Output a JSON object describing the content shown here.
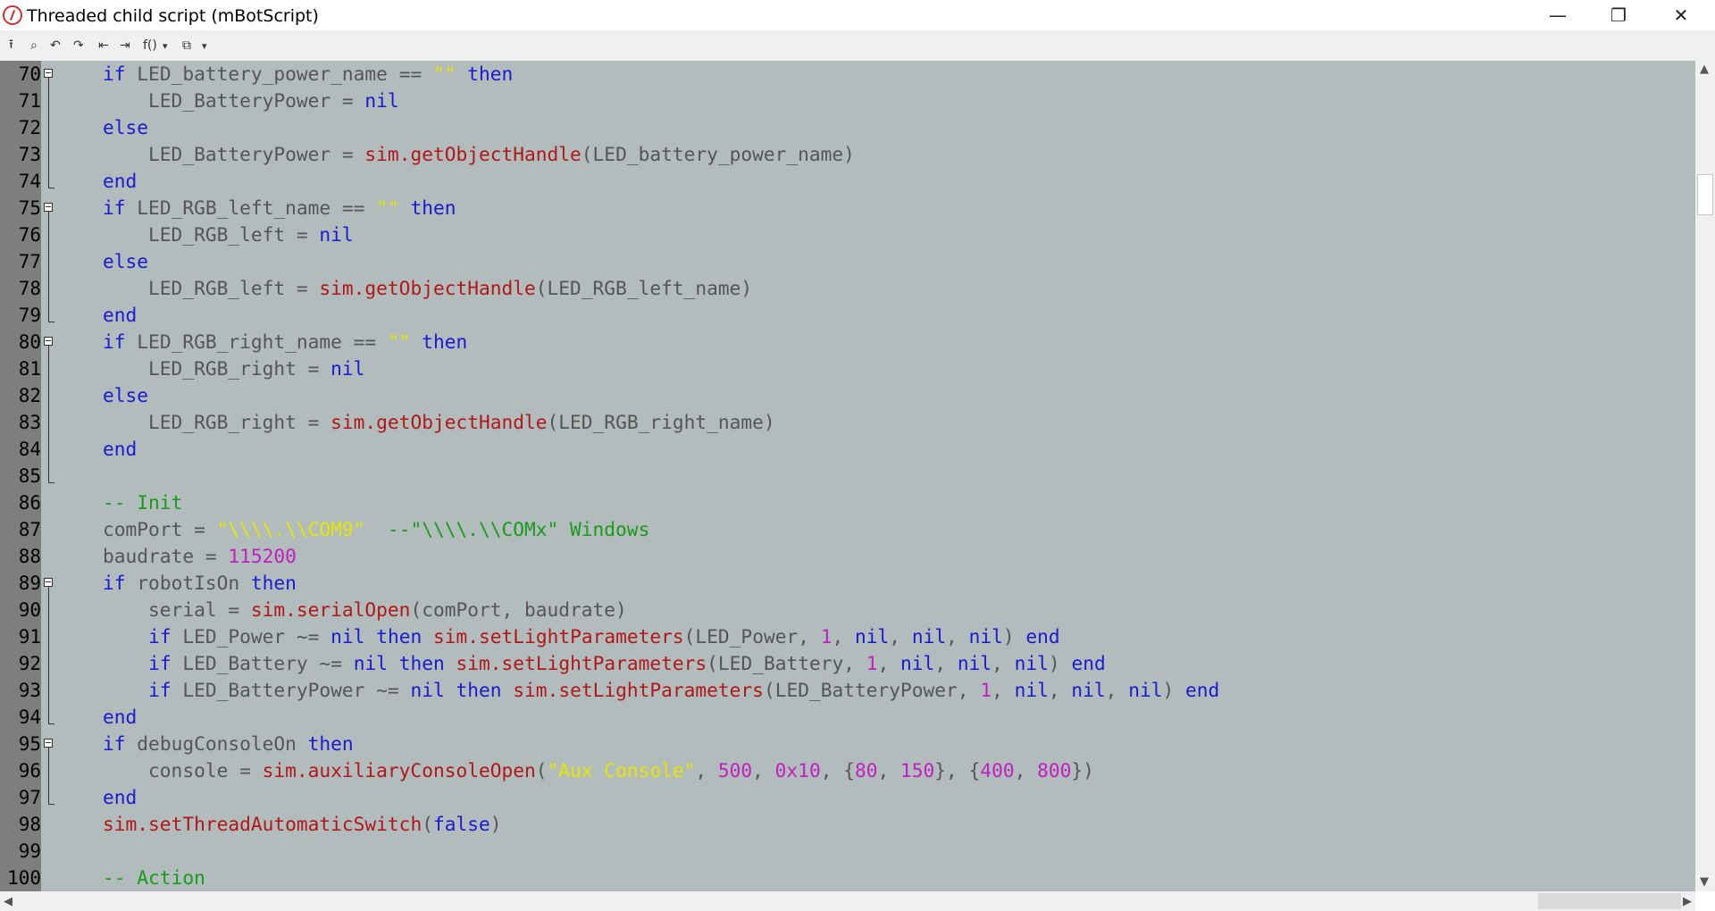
{
  "window": {
    "title": "Threaded child script (mBotScript)",
    "minimize_glyph": "—",
    "restore_glyph": "❐",
    "close_glyph": "✕"
  },
  "toolbar": {
    "buttons": [
      {
        "icon": "upload-icon",
        "glyph": "⭱"
      },
      {
        "icon": "search-icon",
        "glyph": "⌕"
      },
      {
        "icon": "undo-icon",
        "glyph": "↶"
      },
      {
        "icon": "redo-icon",
        "glyph": "↷"
      },
      {
        "icon": "outdent-icon",
        "glyph": "⇤"
      },
      {
        "icon": "indent-icon",
        "glyph": "⇥"
      },
      {
        "icon": "functions-icon",
        "glyph": "f()"
      },
      {
        "icon": "dropdown-icon",
        "glyph": "▾"
      },
      {
        "icon": "snippets-icon",
        "glyph": "⧉"
      },
      {
        "icon": "dropdown-icon",
        "glyph": "▾"
      }
    ]
  },
  "editor": {
    "lines": [
      {
        "n": "70",
        "fold": "start",
        "segs": [
          [
            "p",
            "    "
          ],
          [
            "kw",
            "if"
          ],
          [
            "p",
            " LED_battery_power_name == "
          ],
          [
            "str",
            "\"\""
          ],
          [
            "p",
            " "
          ],
          [
            "kw",
            "then"
          ]
        ]
      },
      {
        "n": "71",
        "fold": "mid",
        "segs": [
          [
            "p",
            "        LED_BatteryPower = "
          ],
          [
            "kw",
            "nil"
          ]
        ]
      },
      {
        "n": "72",
        "fold": "mid",
        "segs": [
          [
            "p",
            "    "
          ],
          [
            "kw",
            "else"
          ]
        ]
      },
      {
        "n": "73",
        "fold": "mid",
        "segs": [
          [
            "p",
            "        LED_BatteryPower = "
          ],
          [
            "fn",
            "sim.getObjectHandle"
          ],
          [
            "p",
            "(LED_battery_power_name)"
          ]
        ]
      },
      {
        "n": "74",
        "fold": "end",
        "segs": [
          [
            "p",
            "    "
          ],
          [
            "kw",
            "end"
          ]
        ]
      },
      {
        "n": "75",
        "fold": "start",
        "segs": [
          [
            "p",
            "    "
          ],
          [
            "kw",
            "if"
          ],
          [
            "p",
            " LED_RGB_left_name == "
          ],
          [
            "str",
            "\"\""
          ],
          [
            "p",
            " "
          ],
          [
            "kw",
            "then"
          ]
        ]
      },
      {
        "n": "76",
        "fold": "mid",
        "segs": [
          [
            "p",
            "        LED_RGB_left = "
          ],
          [
            "kw",
            "nil"
          ]
        ]
      },
      {
        "n": "77",
        "fold": "mid",
        "segs": [
          [
            "p",
            "    "
          ],
          [
            "kw",
            "else"
          ]
        ]
      },
      {
        "n": "78",
        "fold": "mid",
        "segs": [
          [
            "p",
            "        LED_RGB_left = "
          ],
          [
            "fn",
            "sim.getObjectHandle"
          ],
          [
            "p",
            "(LED_RGB_left_name)"
          ]
        ]
      },
      {
        "n": "79",
        "fold": "end",
        "segs": [
          [
            "p",
            "    "
          ],
          [
            "kw",
            "end"
          ]
        ]
      },
      {
        "n": "80",
        "fold": "start",
        "segs": [
          [
            "p",
            "    "
          ],
          [
            "kw",
            "if"
          ],
          [
            "p",
            " LED_RGB_right_name == "
          ],
          [
            "str",
            "\"\""
          ],
          [
            "p",
            " "
          ],
          [
            "kw",
            "then"
          ]
        ]
      },
      {
        "n": "81",
        "fold": "mid",
        "segs": [
          [
            "p",
            "        LED_RGB_right = "
          ],
          [
            "kw",
            "nil"
          ]
        ]
      },
      {
        "n": "82",
        "fold": "mid",
        "segs": [
          [
            "p",
            "    "
          ],
          [
            "kw",
            "else"
          ]
        ]
      },
      {
        "n": "83",
        "fold": "mid",
        "segs": [
          [
            "p",
            "        LED_RGB_right = "
          ],
          [
            "fn",
            "sim.getObjectHandle"
          ],
          [
            "p",
            "(LED_RGB_right_name)"
          ]
        ]
      },
      {
        "n": "84",
        "fold": "mid",
        "segs": [
          [
            "p",
            "    "
          ],
          [
            "kw",
            "end"
          ]
        ]
      },
      {
        "n": "85",
        "fold": "end",
        "segs": []
      },
      {
        "n": "86",
        "fold": "none",
        "segs": [
          [
            "p",
            "    "
          ],
          [
            "cm",
            "-- Init"
          ]
        ]
      },
      {
        "n": "87",
        "fold": "none",
        "segs": [
          [
            "p",
            "    comPort = "
          ],
          [
            "str",
            "\"\\\\\\\\.\\\\COM9\""
          ],
          [
            "p",
            "  "
          ],
          [
            "cm",
            "--\"\\\\\\\\.\\\\COMx\" Windows"
          ]
        ]
      },
      {
        "n": "88",
        "fold": "none",
        "segs": [
          [
            "p",
            "    baudrate = "
          ],
          [
            "num",
            "115200"
          ]
        ]
      },
      {
        "n": "89",
        "fold": "start",
        "segs": [
          [
            "p",
            "    "
          ],
          [
            "kw",
            "if"
          ],
          [
            "p",
            " robotIsOn "
          ],
          [
            "kw",
            "then"
          ]
        ]
      },
      {
        "n": "90",
        "fold": "mid",
        "segs": [
          [
            "p",
            "        serial = "
          ],
          [
            "fn",
            "sim.serialOpen"
          ],
          [
            "p",
            "(comPort, baudrate)"
          ]
        ]
      },
      {
        "n": "91",
        "fold": "mid",
        "segs": [
          [
            "p",
            "        "
          ],
          [
            "kw",
            "if"
          ],
          [
            "p",
            " LED_Power ~= "
          ],
          [
            "kw",
            "nil"
          ],
          [
            "p",
            " "
          ],
          [
            "kw",
            "then"
          ],
          [
            "p",
            " "
          ],
          [
            "fn",
            "sim.setLightParameters"
          ],
          [
            "p",
            "(LED_Power, "
          ],
          [
            "num",
            "1"
          ],
          [
            "p",
            ", "
          ],
          [
            "kw",
            "nil"
          ],
          [
            "p",
            ", "
          ],
          [
            "kw",
            "nil"
          ],
          [
            "p",
            ", "
          ],
          [
            "kw",
            "nil"
          ],
          [
            "p",
            ") "
          ],
          [
            "kw",
            "end"
          ]
        ]
      },
      {
        "n": "92",
        "fold": "mid",
        "segs": [
          [
            "p",
            "        "
          ],
          [
            "kw",
            "if"
          ],
          [
            "p",
            " LED_Battery ~= "
          ],
          [
            "kw",
            "nil"
          ],
          [
            "p",
            " "
          ],
          [
            "kw",
            "then"
          ],
          [
            "p",
            " "
          ],
          [
            "fn",
            "sim.setLightParameters"
          ],
          [
            "p",
            "(LED_Battery, "
          ],
          [
            "num",
            "1"
          ],
          [
            "p",
            ", "
          ],
          [
            "kw",
            "nil"
          ],
          [
            "p",
            ", "
          ],
          [
            "kw",
            "nil"
          ],
          [
            "p",
            ", "
          ],
          [
            "kw",
            "nil"
          ],
          [
            "p",
            ") "
          ],
          [
            "kw",
            "end"
          ]
        ]
      },
      {
        "n": "93",
        "fold": "mid",
        "segs": [
          [
            "p",
            "        "
          ],
          [
            "kw",
            "if"
          ],
          [
            "p",
            " LED_BatteryPower ~= "
          ],
          [
            "kw",
            "nil"
          ],
          [
            "p",
            " "
          ],
          [
            "kw",
            "then"
          ],
          [
            "p",
            " "
          ],
          [
            "fn",
            "sim.setLightParameters"
          ],
          [
            "p",
            "(LED_BatteryPower, "
          ],
          [
            "num",
            "1"
          ],
          [
            "p",
            ", "
          ],
          [
            "kw",
            "nil"
          ],
          [
            "p",
            ", "
          ],
          [
            "kw",
            "nil"
          ],
          [
            "p",
            ", "
          ],
          [
            "kw",
            "nil"
          ],
          [
            "p",
            ") "
          ],
          [
            "kw",
            "end"
          ]
        ]
      },
      {
        "n": "94",
        "fold": "end",
        "segs": [
          [
            "p",
            "    "
          ],
          [
            "kw",
            "end"
          ]
        ]
      },
      {
        "n": "95",
        "fold": "start",
        "segs": [
          [
            "p",
            "    "
          ],
          [
            "kw",
            "if"
          ],
          [
            "p",
            " debugConsoleOn "
          ],
          [
            "kw",
            "then"
          ]
        ]
      },
      {
        "n": "96",
        "fold": "mid",
        "segs": [
          [
            "p",
            "        console = "
          ],
          [
            "fn",
            "sim.auxiliaryConsoleOpen"
          ],
          [
            "p",
            "("
          ],
          [
            "str",
            "\"Aux Console\""
          ],
          [
            "p",
            ", "
          ],
          [
            "num",
            "500"
          ],
          [
            "p",
            ", "
          ],
          [
            "num",
            "0x10"
          ],
          [
            "p",
            ", {"
          ],
          [
            "num",
            "80"
          ],
          [
            "p",
            ", "
          ],
          [
            "num",
            "150"
          ],
          [
            "p",
            "}, {"
          ],
          [
            "num",
            "400"
          ],
          [
            "p",
            ", "
          ],
          [
            "num",
            "800"
          ],
          [
            "p",
            "})"
          ]
        ]
      },
      {
        "n": "97",
        "fold": "end",
        "segs": [
          [
            "p",
            "    "
          ],
          [
            "kw",
            "end"
          ]
        ]
      },
      {
        "n": "98",
        "fold": "none",
        "segs": [
          [
            "p",
            "    "
          ],
          [
            "fn",
            "sim.setThreadAutomaticSwitch"
          ],
          [
            "p",
            "("
          ],
          [
            "kw",
            "false"
          ],
          [
            "p",
            ")"
          ]
        ]
      },
      {
        "n": "99",
        "fold": "none",
        "segs": []
      },
      {
        "n": "100",
        "fold": "none",
        "segs": [
          [
            "p",
            "    "
          ],
          [
            "cm",
            "-- Action"
          ]
        ]
      }
    ]
  },
  "scrollbars": {
    "up_arrow": "▲",
    "down_arrow": "▼",
    "left_arrow": "◀",
    "right_arrow": "▶"
  }
}
